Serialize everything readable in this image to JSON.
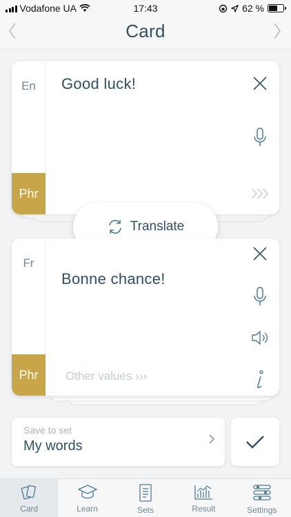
{
  "status": {
    "carrier": "Vodafone UA",
    "time": "17:43",
    "battery": "62 %",
    "battery_level": 0.62
  },
  "header": {
    "title": "Card"
  },
  "source_card": {
    "language": "En",
    "text": "Good luck!",
    "type": "Phr"
  },
  "translate_button": {
    "label": "Translate"
  },
  "target_card": {
    "language": "Fr",
    "text": "Bonne chance!",
    "type": "Phr",
    "other_values": "Other values ›››"
  },
  "save": {
    "label": "Save to set",
    "value": "My words"
  },
  "tabs": [
    {
      "label": "Card",
      "icon": "cards-icon",
      "active": true
    },
    {
      "label": "Learn",
      "icon": "graduation-cap-icon",
      "active": false
    },
    {
      "label": "Sets",
      "icon": "document-list-icon",
      "active": false
    },
    {
      "label": "Result",
      "icon": "bar-chart-icon",
      "active": false
    },
    {
      "label": "Settings",
      "icon": "sliders-icon",
      "active": false
    }
  ],
  "colors": {
    "accent": "#c8a548",
    "text": "#2f4f63",
    "muted": "#6f8796"
  }
}
